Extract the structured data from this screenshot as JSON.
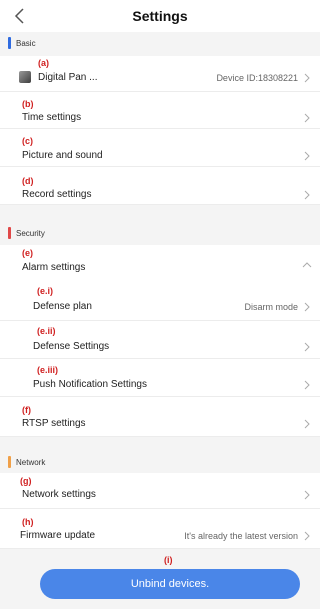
{
  "header": {
    "title": "Settings"
  },
  "colors": {
    "basic": "#2f6be0",
    "security": "#e04848",
    "network": "#f0a048",
    "button": "#4a86e8",
    "tag": "#d02020"
  },
  "sections": {
    "basic": "Basic",
    "security": "Security",
    "network": "Network"
  },
  "rows": {
    "device": {
      "tag": "(a)",
      "label": "Digital Pan ...",
      "value": "Device ID:18308221"
    },
    "time": {
      "tag": "(b)",
      "label": "Time settings"
    },
    "picture": {
      "tag": "(c)",
      "label": "Picture and sound"
    },
    "record": {
      "tag": "(d)",
      "label": "Record settings"
    },
    "alarm": {
      "tag": "(e)",
      "label": "Alarm settings"
    },
    "defense_plan": {
      "tag": "(e.i)",
      "label": "Defense plan",
      "value": "Disarm mode"
    },
    "defense_settings": {
      "tag": "(e.ii)",
      "label": "Defense Settings"
    },
    "push": {
      "tag": "(e.iii)",
      "label": "Push Notification Settings"
    },
    "rtsp": {
      "tag": "(f)",
      "label": "RTSP settings"
    },
    "network": {
      "tag": "(g)",
      "label": "Network settings"
    },
    "firmware": {
      "tag": "(h)",
      "label": "Firmware update",
      "value": "It's already the latest version"
    }
  },
  "footer": {
    "tag": "(i)",
    "button": "Unbind devices."
  },
  "icons": {
    "back": "chevron-left-icon",
    "row": "chevron-right-icon",
    "alarm": "chevron-up-icon"
  }
}
